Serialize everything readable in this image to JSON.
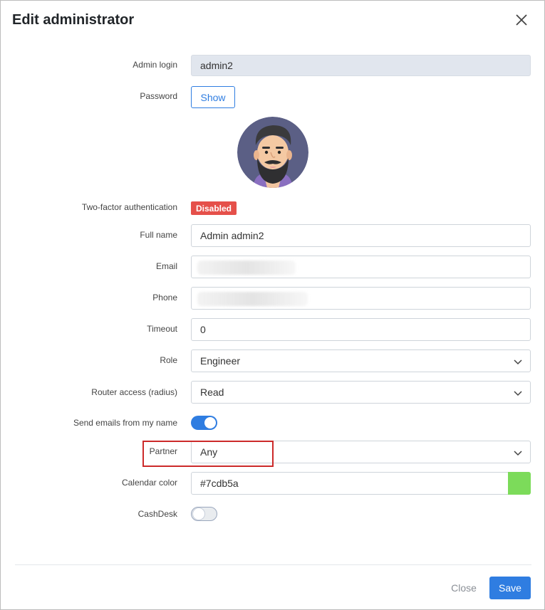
{
  "dialog": {
    "title": "Edit administrator"
  },
  "form": {
    "admin_login": {
      "label": "Admin login",
      "value": "admin2"
    },
    "password": {
      "label": "Password",
      "button": "Show"
    },
    "two_factor": {
      "label": "Two-factor authentication",
      "status": "Disabled"
    },
    "full_name": {
      "label": "Full name",
      "value": "Admin admin2"
    },
    "email": {
      "label": "Email",
      "value": ""
    },
    "phone": {
      "label": "Phone",
      "value": ""
    },
    "timeout": {
      "label": "Timeout",
      "value": "0"
    },
    "role": {
      "label": "Role",
      "value": "Engineer"
    },
    "router_access": {
      "label": "Router access (radius)",
      "value": "Read"
    },
    "send_emails": {
      "label": "Send emails from my name",
      "enabled": true
    },
    "partner": {
      "label": "Partner",
      "value": "Any"
    },
    "calendar_color": {
      "label": "Calendar color",
      "value": "#7cdb5a",
      "swatch": "#7cdb5a"
    },
    "cashdesk": {
      "label": "CashDesk",
      "enabled": false
    }
  },
  "footer": {
    "close_label": "Close",
    "save_label": "Save"
  },
  "colors": {
    "accent": "#2f7de1",
    "danger": "#e5504a",
    "highlight": "#cc2a2a"
  },
  "icons": {
    "close": "close-icon",
    "chevron": "chevron-down-icon"
  }
}
